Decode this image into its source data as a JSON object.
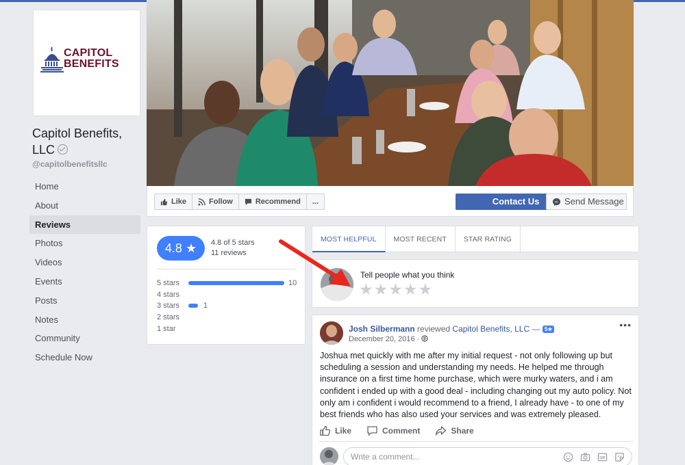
{
  "logo": {
    "line1": "CAPITOL",
    "line2": "BENEFITS",
    "brand_color": "#6b1030"
  },
  "page": {
    "name": "Capitol Benefits, LLC",
    "handle": "@capitolbenefitsllc"
  },
  "nav": {
    "items": [
      {
        "label": "Home",
        "active": false
      },
      {
        "label": "About",
        "active": false
      },
      {
        "label": "Reviews",
        "active": true
      },
      {
        "label": "Photos",
        "active": false
      },
      {
        "label": "Videos",
        "active": false
      },
      {
        "label": "Events",
        "active": false
      },
      {
        "label": "Posts",
        "active": false
      },
      {
        "label": "Notes",
        "active": false
      },
      {
        "label": "Community",
        "active": false
      },
      {
        "label": "Schedule Now",
        "active": false
      }
    ]
  },
  "actions": {
    "like": "Like",
    "follow": "Follow",
    "recommend": "Recommend",
    "more": "...",
    "contact": "Contact Us",
    "send_message": "Send Message"
  },
  "rating": {
    "score": "4.8",
    "summary": "4.8 of 5 stars",
    "reviews": "11 reviews",
    "breakdown": [
      {
        "label": "5 stars",
        "fraction": 1.0,
        "count": "10"
      },
      {
        "label": "4 stars",
        "fraction": 0,
        "count": ""
      },
      {
        "label": "3 stars",
        "fraction": 0.1,
        "count": "1"
      },
      {
        "label": "2 stars",
        "fraction": 0,
        "count": ""
      },
      {
        "label": "1 star",
        "fraction": 0,
        "count": ""
      }
    ]
  },
  "tabs": [
    {
      "label": "MOST HELPFUL",
      "active": true
    },
    {
      "label": "MOST RECENT",
      "active": false
    },
    {
      "label": "STAR RATING",
      "active": false
    }
  ],
  "prompt": {
    "text": "Tell people what you think"
  },
  "review": {
    "author": "Josh Silbermann",
    "verb": "reviewed",
    "page": "Capitol Benefits, LLC",
    "dash": "—",
    "badge": "5★",
    "date": "December 20, 2016 ·",
    "body": "Joshua met quickly with me after my initial request - not only following up but scheduling a session and understanding my needs. He helped me through insurance on a first time home purchase, which were murky waters, and i am confident i ended up with a good deal - including changing out my auto policy. Not only am i confident i would recommend to a friend, I already have - to one of my best friends who has also used your services and was extremely pleased.",
    "like": "Like",
    "comment": "Comment",
    "share": "Share",
    "comment_placeholder": "Write a comment..."
  },
  "colors": {
    "accent": "#4267b2",
    "rating_blue": "#4080ff",
    "annotation_red": "#e8281e"
  }
}
